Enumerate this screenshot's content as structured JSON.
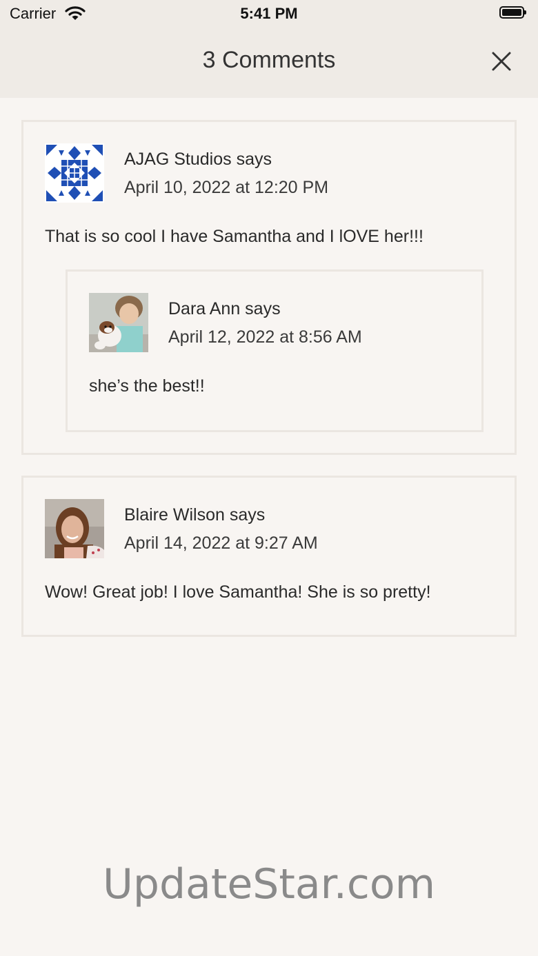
{
  "status_bar": {
    "carrier": "Carrier",
    "time": "5:41 PM"
  },
  "header": {
    "title": "3 Comments",
    "close_icon": "close-icon"
  },
  "comments": [
    {
      "author": "AJAG Studios says",
      "date": "April 10, 2022 at 12:20 PM",
      "text": "That is so cool I have Samantha and I lOVE her!!!",
      "avatar": "quilt-pattern-avatar",
      "replies": [
        {
          "author": "Dara Ann says",
          "date": "April 12, 2022 at 8:56 AM",
          "text": "she’s the best!!",
          "avatar": "doll-photo-avatar"
        }
      ]
    },
    {
      "author": "Blaire Wilson says",
      "date": "April 14, 2022 at 9:27 AM",
      "text": "Wow! Great job! I love Samantha! She is so pretty!",
      "avatar": "girl-photo-avatar"
    }
  ],
  "watermark": "UpdateStar.com",
  "colors": {
    "background": "#f8f5f2",
    "header": "#efebe6",
    "card_border": "#ebe6e1",
    "quilt_blue": "#1f4fb5"
  }
}
